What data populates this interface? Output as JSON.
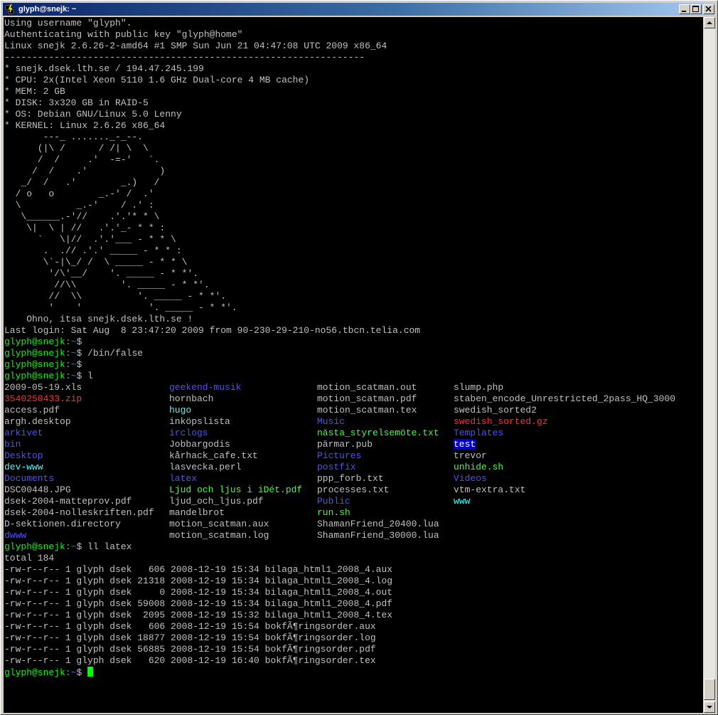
{
  "window": {
    "title": "glyph@snejk: ~",
    "icon": "putty-icon",
    "buttons": {
      "minimize": "minimize-icon",
      "maximize": "maximize-icon",
      "close": "close-icon"
    }
  },
  "colors": {
    "background": "#000000",
    "text": "#c0c0c0",
    "prompt": "#00ff00",
    "path": "#6060ff",
    "directory": "#5050ff",
    "archive": "#ff3030",
    "executable": "#40ff40",
    "link": "#40ffff",
    "highlight_bg": "#0000c0",
    "cursor": "#00ff00"
  },
  "prompt": {
    "user_host": "glyph@snejk:",
    "path": "~",
    "symbol": "$"
  },
  "lines": [
    {
      "kind": "text",
      "text": "Using username \"glyph\"."
    },
    {
      "kind": "text",
      "text": "Authenticating with public key \"glyph@home\""
    },
    {
      "kind": "text",
      "text": "Linux snejk 2.6.26-2-amd64 #1 SMP Sun Jun 21 04:47:08 UTC 2009 x86_64"
    },
    {
      "kind": "text",
      "text": "-----------------------------------------------------------------"
    },
    {
      "kind": "text",
      "text": "* snejk.dsek.lth.se / 194.47.245.199"
    },
    {
      "kind": "text",
      "text": "* CPU: 2x(Intel Xeon 5110 1.6 GHz Dual-core 4 MB cache)"
    },
    {
      "kind": "text",
      "text": "* MEM: 2 GB"
    },
    {
      "kind": "text",
      "text": "* DISK: 3x320 GB in RAID-5"
    },
    {
      "kind": "text",
      "text": "* OS: Debian GNU/Linux 5.0 Lenny"
    },
    {
      "kind": "text",
      "text": "* KERNEL: Linux 2.6.26 x86_64"
    },
    {
      "kind": "text",
      "text": "       ---_ ......._-_--."
    },
    {
      "kind": "text",
      "text": "      (|\\ /      / /| \\  \\"
    },
    {
      "kind": "text",
      "text": "      /  /     .'  -=-'   `."
    },
    {
      "kind": "text",
      "text": "     /  /    .'             )"
    },
    {
      "kind": "text",
      "text": "   _/  /   .'        _.)   /"
    },
    {
      "kind": "text",
      "text": "  / o   o        _.-' /  .'"
    },
    {
      "kind": "text",
      "text": "  \\          _.-'    / .' :"
    },
    {
      "kind": "text",
      "text": "   \\______.-'//    .'.'* * \\"
    },
    {
      "kind": "text",
      "text": "    \\|  \\ | //   .'.'_- * * :"
    },
    {
      "kind": "text",
      "text": "      `   \\|//  .'.'___ - * * \\"
    },
    {
      "kind": "text",
      "text": "       .  .// .'.' _____ - * * :"
    },
    {
      "kind": "text",
      "text": "       \\`-|\\_/ /  \\ _____ - * * \\"
    },
    {
      "kind": "text",
      "text": "        '/\\'__/    '. _____ - * *'."
    },
    {
      "kind": "text",
      "text": "         //\\\\        '. _____ - * *'."
    },
    {
      "kind": "text",
      "text": "        //  \\\\          '. _____ - * *'."
    },
    {
      "kind": "text",
      "text": "        '    '            '. _____ - * *'."
    },
    {
      "kind": "text",
      "text": "    Ohno, itsa snejk.dsek.lth.se !"
    },
    {
      "kind": "text",
      "text": "Last login: Sat Aug  8 23:47:20 2009 from 90-230-29-210-no56.tbcn.telia.com"
    },
    {
      "kind": "prompt",
      "cmd": ""
    },
    {
      "kind": "prompt",
      "cmd": " /bin/false"
    },
    {
      "kind": "prompt",
      "cmd": ""
    },
    {
      "kind": "prompt",
      "cmd": " l"
    },
    {
      "kind": "ls",
      "cells": [
        {
          "t": "2009-05-19.xls",
          "c": "grey"
        },
        {
          "t": "geekend-musik",
          "c": "dir"
        },
        {
          "t": "motion_scatman.out",
          "c": "grey"
        },
        {
          "t": "slump.php",
          "c": "grey"
        }
      ]
    },
    {
      "kind": "ls",
      "cells": [
        {
          "t": "3540250433.zip",
          "c": "red"
        },
        {
          "t": "hornbach",
          "c": "grey"
        },
        {
          "t": "motion_scatman.pdf",
          "c": "grey"
        },
        {
          "t": "staben_encode_Unrestricted_2pass_HQ_3000",
          "c": "grey"
        }
      ]
    },
    {
      "kind": "ls",
      "cells": [
        {
          "t": "access.pdf",
          "c": "grey"
        },
        {
          "t": "hugo",
          "c": "cyan"
        },
        {
          "t": "motion_scatman.tex",
          "c": "grey"
        },
        {
          "t": "swedish_sorted2",
          "c": "grey"
        }
      ]
    },
    {
      "kind": "ls",
      "cells": [
        {
          "t": "argh.desktop",
          "c": "grey"
        },
        {
          "t": "inköpslista",
          "c": "grey"
        },
        {
          "t": "Music",
          "c": "dir"
        },
        {
          "t": "swedish_sorted.gz",
          "c": "red"
        }
      ]
    },
    {
      "kind": "ls",
      "cells": [
        {
          "t": "arkivet",
          "c": "dir"
        },
        {
          "t": "irclogs",
          "c": "dir"
        },
        {
          "t": "nästa_styrelsemöte.txt",
          "c": "exe"
        },
        {
          "t": "Templates",
          "c": "dir"
        }
      ]
    },
    {
      "kind": "ls",
      "cells": [
        {
          "t": "bin",
          "c": "dir"
        },
        {
          "t": "Jobbargodis",
          "c": "grey"
        },
        {
          "t": "pärmar.pub",
          "c": "grey"
        },
        {
          "t": "test",
          "c": "hl"
        }
      ]
    },
    {
      "kind": "ls",
      "cells": [
        {
          "t": "Desktop",
          "c": "dir"
        },
        {
          "t": "kårhack_cafe.txt",
          "c": "grey"
        },
        {
          "t": "Pictures",
          "c": "dir"
        },
        {
          "t": "trevor",
          "c": "grey"
        }
      ]
    },
    {
      "kind": "ls",
      "cells": [
        {
          "t": "dev-www",
          "c": "cyan"
        },
        {
          "t": "lasvecka.perl",
          "c": "grey"
        },
        {
          "t": "postfix",
          "c": "dir"
        },
        {
          "t": "unhide.sh",
          "c": "exe"
        }
      ]
    },
    {
      "kind": "ls",
      "cells": [
        {
          "t": "Documents",
          "c": "dir"
        },
        {
          "t": "latex",
          "c": "dir"
        },
        {
          "t": "ppp_forb.txt",
          "c": "grey"
        },
        {
          "t": "Videos",
          "c": "dir"
        }
      ]
    },
    {
      "kind": "ls",
      "cells": [
        {
          "t": "DSC00448.JPG",
          "c": "grey"
        },
        {
          "t": "Ljud och ljus i iDét.pdf",
          "c": "exe"
        },
        {
          "t": "processes.txt",
          "c": "grey"
        },
        {
          "t": "vtm-extra.txt",
          "c": "grey"
        }
      ]
    },
    {
      "kind": "ls",
      "cells": [
        {
          "t": "dsek-2004-matteprov.pdf",
          "c": "grey"
        },
        {
          "t": "ljud_och_ljus.pdf",
          "c": "grey"
        },
        {
          "t": "Public",
          "c": "dir"
        },
        {
          "t": "www",
          "c": "cyan"
        }
      ]
    },
    {
      "kind": "ls",
      "cells": [
        {
          "t": "dsek-2004-nolleskriften.pdf",
          "c": "grey"
        },
        {
          "t": "mandelbrot",
          "c": "grey"
        },
        {
          "t": "run.sh",
          "c": "exe"
        },
        {
          "t": "",
          "c": "grey"
        }
      ]
    },
    {
      "kind": "ls",
      "cells": [
        {
          "t": "D-sektionen.directory",
          "c": "grey"
        },
        {
          "t": "motion_scatman.aux",
          "c": "grey"
        },
        {
          "t": "ShamanFriend_20400.lua",
          "c": "grey"
        },
        {
          "t": "",
          "c": "grey"
        }
      ]
    },
    {
      "kind": "ls",
      "cells": [
        {
          "t": "dwww",
          "c": "dir"
        },
        {
          "t": "motion_scatman.log",
          "c": "grey"
        },
        {
          "t": "ShamanFriend_30000.lua",
          "c": "grey"
        },
        {
          "t": "",
          "c": "grey"
        }
      ]
    },
    {
      "kind": "prompt",
      "cmd": " ll latex"
    },
    {
      "kind": "text",
      "text": "total 184"
    },
    {
      "kind": "text",
      "text": "-rw-r--r-- 1 glyph dsek   606 2008-12-19 15:34 bilaga_html1_2008_4.aux"
    },
    {
      "kind": "text",
      "text": "-rw-r--r-- 1 glyph dsek 21318 2008-12-19 15:34 bilaga_html1_2008_4.log"
    },
    {
      "kind": "text",
      "text": "-rw-r--r-- 1 glyph dsek     0 2008-12-19 15:34 bilaga_html1_2008_4.out"
    },
    {
      "kind": "text",
      "text": "-rw-r--r-- 1 glyph dsek 59008 2008-12-19 15:34 bilaga_html1_2008_4.pdf"
    },
    {
      "kind": "text",
      "text": "-rw-r--r-- 1 glyph dsek  2095 2008-12-19 15:32 bilaga_html1_2008_4.tex"
    },
    {
      "kind": "text",
      "text": "-rw-r--r-- 1 glyph dsek   606 2008-12-19 15:54 bokfÃ¶ringsorder.aux"
    },
    {
      "kind": "text",
      "text": "-rw-r--r-- 1 glyph dsek 18877 2008-12-19 15:54 bokfÃ¶ringsorder.log"
    },
    {
      "kind": "text",
      "text": "-rw-r--r-- 1 glyph dsek 56885 2008-12-19 15:54 bokfÃ¶ringsorder.pdf"
    },
    {
      "kind": "text",
      "text": "-rw-r--r-- 1 glyph dsek   620 2008-12-19 16:40 bokfÃ¶ringsorder.tex"
    },
    {
      "kind": "prompt",
      "cmd": " ",
      "cursor": true
    }
  ]
}
